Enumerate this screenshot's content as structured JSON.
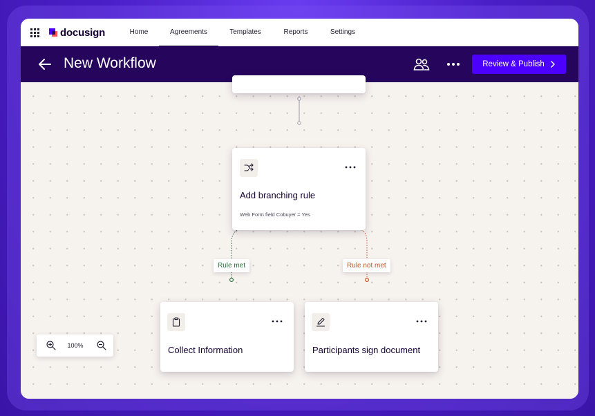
{
  "brand": {
    "name": "docusign"
  },
  "nav": {
    "tabs": [
      {
        "label": "Home",
        "active": false
      },
      {
        "label": "Agreements",
        "active": true
      },
      {
        "label": "Templates",
        "active": false
      },
      {
        "label": "Reports",
        "active": false
      },
      {
        "label": "Settings",
        "active": false
      }
    ]
  },
  "header": {
    "title": "New Workflow",
    "publish_label": "Review & Publish"
  },
  "workflow": {
    "branch_card": {
      "icon": "branching-icon",
      "title": "Add branching rule",
      "subtitle": "Web Form field  Cobuyer = Yes"
    },
    "branches": {
      "met_label": "Rule met",
      "not_met_label": "Rule not met"
    },
    "steps": [
      {
        "icon": "clipboard-icon",
        "title": "Collect Information"
      },
      {
        "icon": "pen-icon",
        "title": "Participants sign document"
      }
    ]
  },
  "zoom": {
    "level": "100%"
  },
  "colors": {
    "header_bg": "#26065d",
    "accent": "#4c00ff",
    "rule_met": "#2e6b3a",
    "rule_not_met": "#c2501f",
    "canvas_bg": "#f6f2ee"
  }
}
